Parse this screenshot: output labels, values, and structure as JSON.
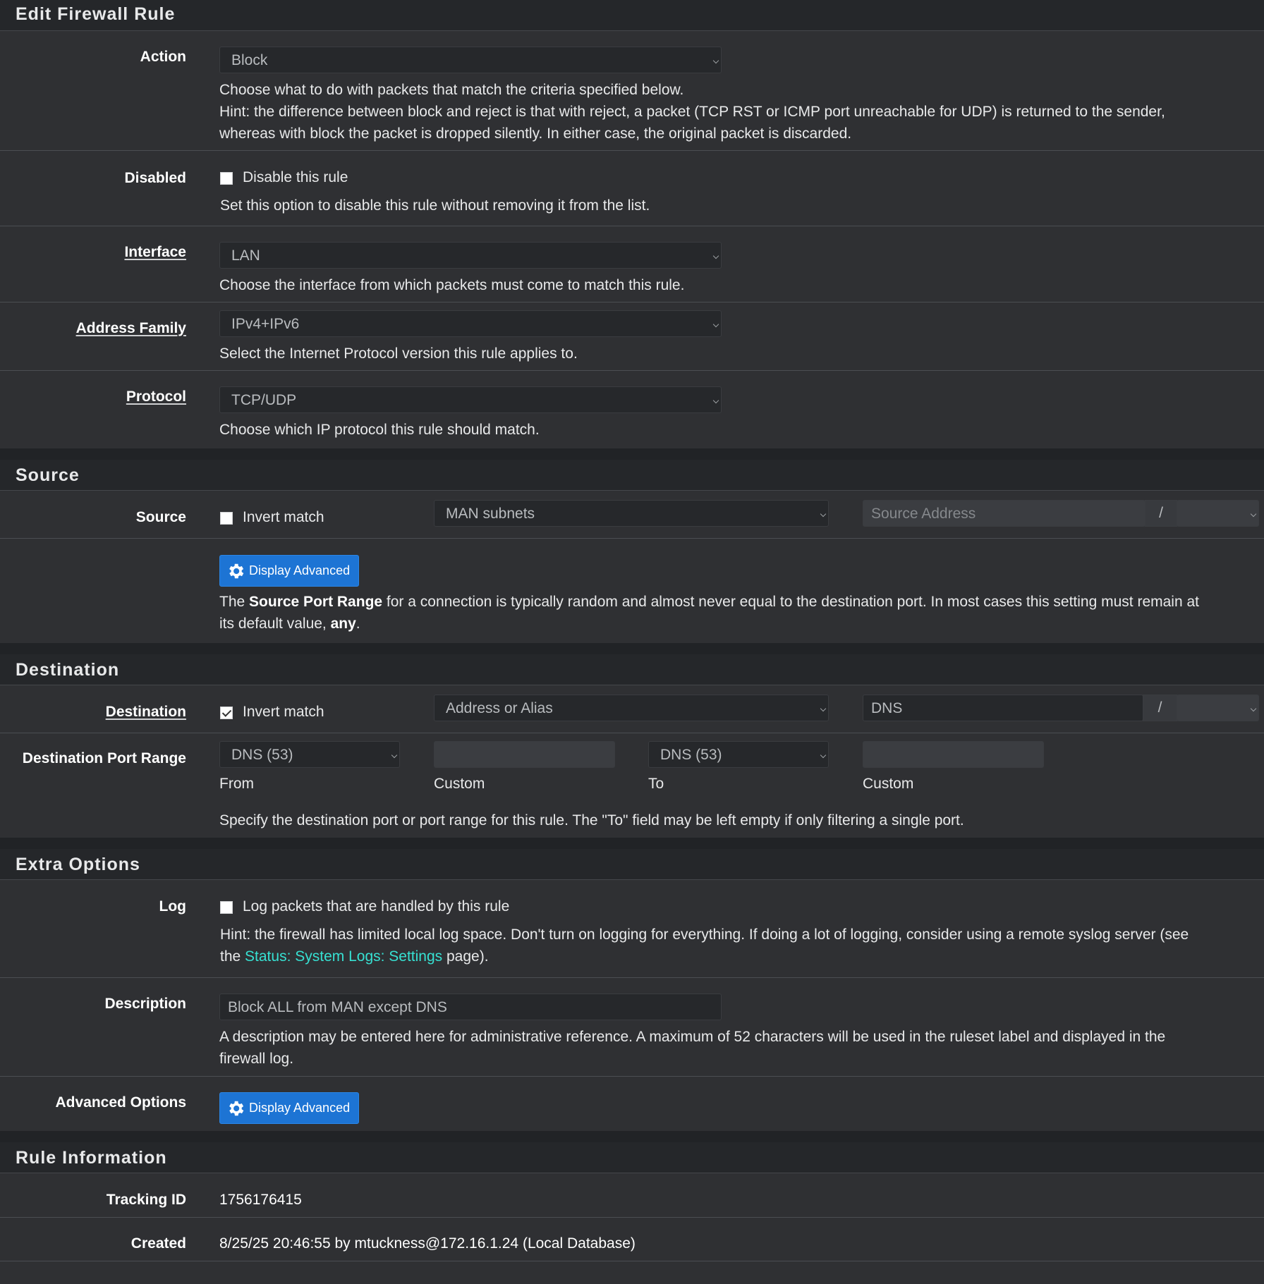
{
  "edit": {
    "title": "Edit Firewall Rule",
    "action": {
      "label": "Action",
      "value": "Block",
      "help1": "Choose what to do with packets that match the criteria specified below.",
      "help2": "Hint: the difference between block and reject is that with reject, a packet (TCP RST or ICMP port unreachable for UDP) is returned to the sender,",
      "help3": "whereas with block the packet is dropped silently. In either case, the original packet is discarded."
    },
    "disabled": {
      "label": "Disabled",
      "checkbox_label": "Disable this rule",
      "checked": false,
      "help": "Set this option to disable this rule without removing it from the list."
    },
    "interface": {
      "label": "Interface",
      "value": "LAN",
      "help": "Choose the interface from which packets must come to match this rule."
    },
    "address_family": {
      "label": "Address Family",
      "value": "IPv4+IPv6",
      "help": "Select the Internet Protocol version this rule applies to."
    },
    "protocol": {
      "label": "Protocol",
      "value": "TCP/UDP",
      "help": "Choose which IP protocol this rule should match."
    }
  },
  "source": {
    "title": "Source",
    "label": "Source",
    "invert_label": "Invert match",
    "invert_checked": false,
    "type_value": "MAN subnets",
    "address_placeholder": "Source Address",
    "slash": "/",
    "advanced_button": "Display Advanced",
    "help_pre": "The ",
    "help_bold1": "Source Port Range",
    "help_mid": " for a connection is typically random and almost never equal to the destination port. In most cases this setting must remain at",
    "help_line2_pre": "its default value, ",
    "help_bold2": "any",
    "help_end": "."
  },
  "destination": {
    "title": "Destination",
    "label": "Destination",
    "invert_label": "Invert match",
    "invert_checked": true,
    "type_value": "Address or Alias",
    "address_value": "DNS",
    "slash": "/",
    "port_range_label": "Destination Port Range",
    "from_value": "DNS (53)",
    "to_value": "DNS (53)",
    "from_label": "From",
    "custom_label": "Custom",
    "to_label": "To",
    "help": "Specify the destination port or port range for this rule. The \"To\" field may be left empty if only filtering a single port."
  },
  "extra": {
    "title": "Extra Options",
    "log_label": "Log",
    "log_checkbox_label": "Log packets that are handled by this rule",
    "log_checked": false,
    "log_help1": "Hint: the firewall has limited local log space. Don't turn on logging for everything. If doing a lot of logging, consider using a remote syslog server (see",
    "log_help2_pre": "the ",
    "log_help2_link": "Status: System Logs: Settings",
    "log_help2_post": " page).",
    "description_label": "Description",
    "description_value": "Block ALL from MAN except DNS",
    "description_help1": "A description may be entered here for administrative reference. A maximum of 52 characters will be used in the ruleset label and displayed in the",
    "description_help2": "firewall log.",
    "advanced_label": "Advanced Options",
    "advanced_button": "Display Advanced"
  },
  "rule_info": {
    "title": "Rule Information",
    "tracking_label": "Tracking ID",
    "tracking_value": "1756176415",
    "created_label": "Created",
    "created_value": "8/25/25 20:46:55 by mtuckness@172.16.1.24 (Local Database)"
  },
  "colors": {
    "background": "#2f3033",
    "header": "#25272a",
    "button": "#1d74d4",
    "link": "#37e0d2"
  },
  "icons": {
    "gear": "gear-icon",
    "caret": "chevron-down-icon"
  }
}
